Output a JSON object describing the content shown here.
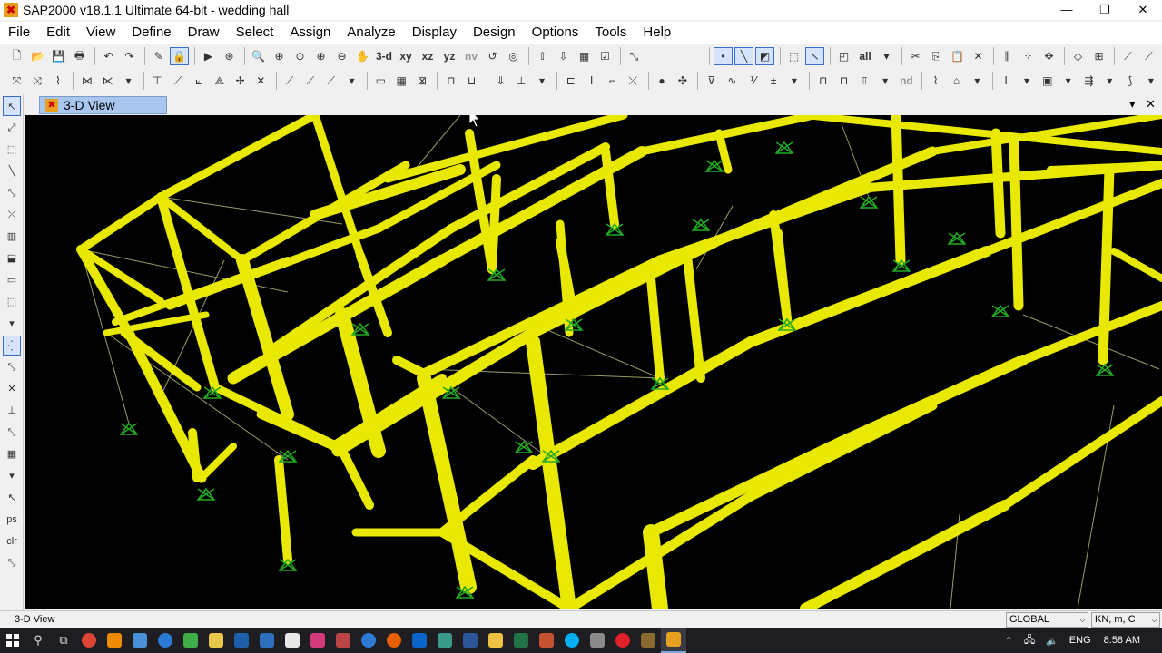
{
  "window": {
    "title": "SAP2000 v18.1.1 Ultimate 64-bit - wedding hall"
  },
  "menu": [
    "File",
    "Edit",
    "View",
    "Define",
    "Draw",
    "Select",
    "Assign",
    "Analyze",
    "Display",
    "Design",
    "Options",
    "Tools",
    "Help"
  ],
  "toolbar": {
    "view_3d": "3-d",
    "view_xy": "xy",
    "view_xz": "xz",
    "view_yz": "yz",
    "view_nv": "nv",
    "all_label": "all",
    "nd_label": "nd"
  },
  "view_tab": {
    "label": "3-D View"
  },
  "status": {
    "view_name": "3-D View",
    "coord_system": "GLOBAL",
    "units": "KN, m, C"
  },
  "tray": {
    "language": "ENG",
    "time": "8:58 AM"
  },
  "colors": {
    "frame": "#e8e800",
    "support": "#22aa22",
    "bracing": "#9a9a6a",
    "background": "#000000"
  }
}
